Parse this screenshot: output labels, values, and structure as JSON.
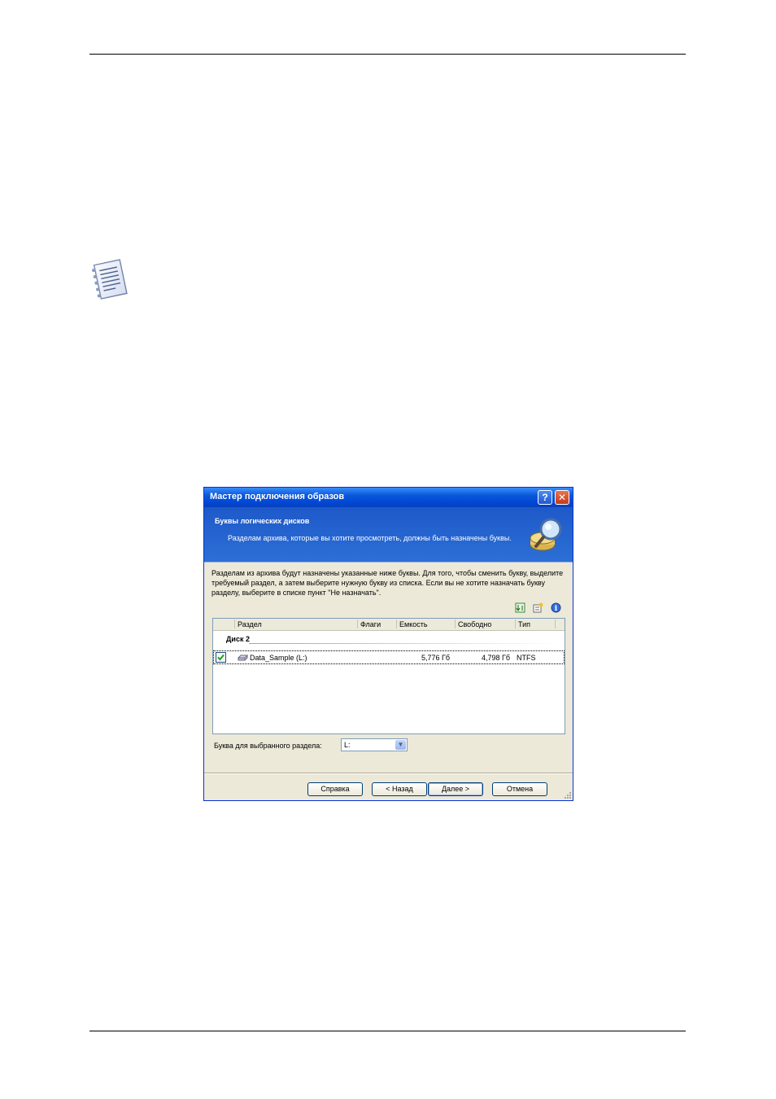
{
  "dialog": {
    "title": "Мастер подключения образов",
    "header_title": "Буквы логических дисков",
    "header_subtitle": "Разделам архива, которые вы хотите просмотреть, должны быть назначены буквы.",
    "body_text": "Разделам из архива будут назначены указанные ниже буквы. Для того, чтобы сменить букву, выделите требуемый раздел, а затем выберите нужную букву из списка. Если вы не хотите назначать букву разделу, выберите в списке пункт \"Не назначать\".",
    "columns": [
      "Раздел",
      "Флаги",
      "Емкость",
      "Свободно",
      "Тип"
    ],
    "group": "Диск 2",
    "row": {
      "name": "Data_Sample (L:)",
      "flags": "",
      "capacity": "5,776 Гб",
      "free": "4,798 Гб",
      "type": "NTFS",
      "checked": true
    },
    "letter_label": "Буква для выбранного раздела:",
    "letter_value": "L:",
    "buttons": {
      "help": "Справка",
      "back": "< Назад",
      "next": "Далее >",
      "cancel": "Отмена"
    }
  },
  "colors": {
    "title_bar": "#0a58d8",
    "header_bg": "#2c6fd6",
    "dialog_bg": "#ece9d8"
  }
}
